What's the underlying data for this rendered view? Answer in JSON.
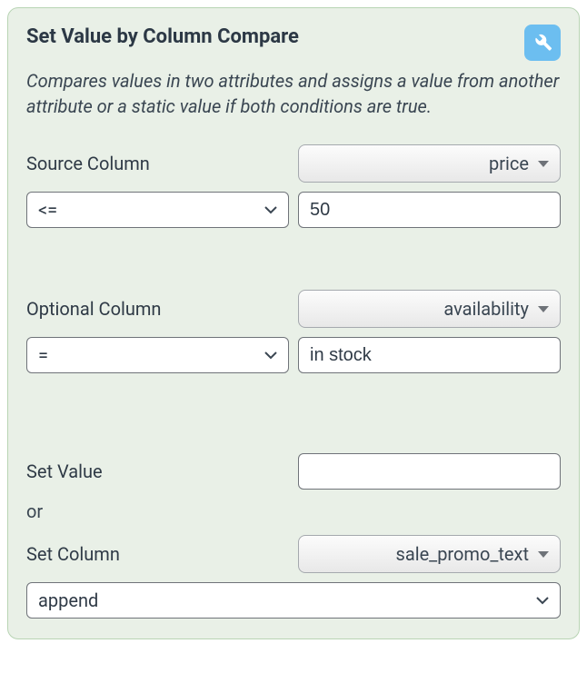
{
  "panel": {
    "title": "Set Value by Column Compare",
    "description": "Compares values in two attributes and assigns a value from another attribute or a static value if both conditions are true.",
    "wrench_icon": "wrench-icon"
  },
  "source": {
    "label": "Source Column",
    "column_selected": "price",
    "operator_selected": "<=",
    "value": "50"
  },
  "optional": {
    "label": "Optional Column",
    "column_selected": "availability",
    "operator_selected": "=",
    "value": "in stock"
  },
  "setvalue": {
    "label": "Set Value",
    "value": ""
  },
  "or_label": "or",
  "setcolumn": {
    "label": "Set Column",
    "column_selected": "sale_promo_text",
    "mode_selected": "append"
  }
}
